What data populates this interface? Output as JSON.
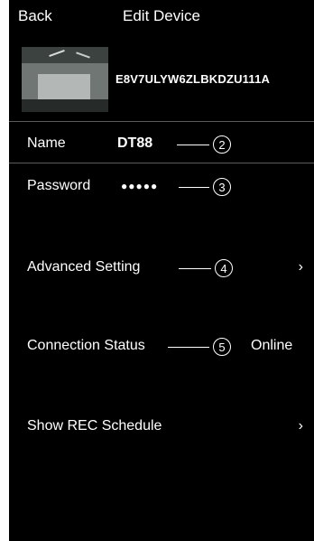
{
  "nav": {
    "back_label": "Back",
    "title": "Edit Device"
  },
  "device": {
    "uid": "E8V7ULYW6ZLBKDZU111A"
  },
  "fields": {
    "name_label": "Name",
    "name_value": "DT88",
    "password_label": "Password",
    "password_value": "●●●●●"
  },
  "menu": {
    "advanced_label": "Advanced Setting",
    "connection_label": "Connection Status",
    "connection_value": "Online",
    "rec_label": "Show REC Schedule",
    "chevron": "›"
  },
  "callouts": {
    "c2": "2",
    "c3": "3",
    "c4": "4",
    "c5": "5"
  }
}
